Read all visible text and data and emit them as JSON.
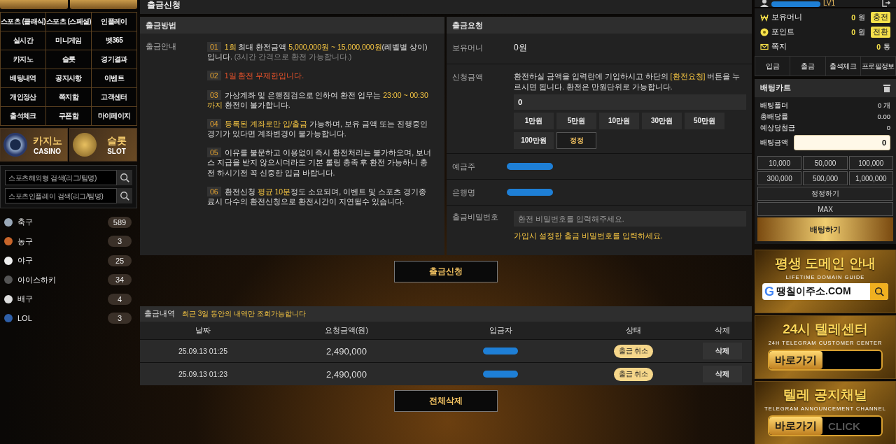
{
  "menu": [
    {
      "label": "스포츠 (클래식)"
    },
    {
      "label": "스포츠 (스페셜)"
    },
    {
      "label": "인플레이"
    },
    {
      "label": "실시간"
    },
    {
      "label": "미니게임"
    },
    {
      "label": "벳365"
    },
    {
      "label": "카지노"
    },
    {
      "label": "슬롯"
    },
    {
      "label": "경기결과"
    },
    {
      "label": "배팅내역"
    },
    {
      "label": "공지사항"
    },
    {
      "label": "이벤트"
    },
    {
      "label": "개인정산"
    },
    {
      "label": "쪽지함"
    },
    {
      "label": "고객센터"
    },
    {
      "label": "출석체크"
    },
    {
      "label": "쿠폰함"
    },
    {
      "label": "마이페이지"
    }
  ],
  "promo_banners": [
    {
      "kind": "casino",
      "title": "카지노",
      "subtitle": "CASINO"
    },
    {
      "kind": "slot",
      "title": "슬롯",
      "subtitle": "SLOT"
    }
  ],
  "search_fields": [
    {
      "placeholder": "스포츠해외형 검색(리그/팀명)"
    },
    {
      "placeholder": "스포츠인플레이 검색(리그/팀명)"
    }
  ],
  "sports": [
    {
      "kind": "soccer",
      "name": "축구",
      "count": "589"
    },
    {
      "kind": "basketball",
      "name": "농구",
      "count": "3"
    },
    {
      "kind": "baseball",
      "name": "야구",
      "count": "25"
    },
    {
      "kind": "hockey",
      "name": "아이스하키",
      "count": "34"
    },
    {
      "kind": "volleyball",
      "name": "배구",
      "count": "4"
    },
    {
      "kind": "lol",
      "name": "LOL",
      "count": "3"
    }
  ],
  "page_title": "출금신청",
  "method_panel": {
    "title": "출금방법",
    "label": "출금안내",
    "notices": [
      {
        "number": "01",
        "kind": "normal",
        "text": "**1회** 최대 환전금액 **5,000,000원 ~ 15,000,000원**(레벨별 상이) 입니다. *(3시간 간격으로 환전 가능합니다.)*"
      },
      {
        "number": "02",
        "kind": "warning",
        "text": "1일 환전 무제한입니다."
      },
      {
        "number": "03",
        "kind": "normal",
        "text": "가상계좌 및 은행점검으로 인하여 환전 업무는 **23:00 ~ 00:30 까지** 환전이 불가합니다."
      },
      {
        "number": "04",
        "kind": "normal",
        "text": "**등록된 계좌로만 입/출금** 가능하며, 보유 금액 또는 진행중인 경기가 있다면 계좌변경이 불가능합니다."
      },
      {
        "number": "05",
        "kind": "normal",
        "text": "이유를 불문하고 이용없이 즉시 환전처리는 불가하오며, 보너스 지급을 받지 않으시더라도 기본 롤링 충족 후 환전 가능하니 충전 하시기전 꼭 신중한 입금 바랍니다."
      },
      {
        "number": "06",
        "kind": "normal",
        "text": "환전신청 **평균 10분**정도 소요되며, 이벤트 및 스포츠 경기종료시 다수의 환전신청으로 환전시간이 지연될수 있습니다."
      }
    ]
  },
  "request_panel": {
    "title": "출금요청",
    "rows": [
      {
        "kind": "text",
        "label": "보유머니",
        "value": "0원"
      },
      {
        "kind": "amount",
        "label": "신청금액",
        "description": "환전하실 금액을 입력란에 기입하시고 하단의 **[환전요청]** 버튼을 누르시면 됩니다. 환전은 만원단위로 가능합니다.",
        "value": "0",
        "buttons": [
          "1만원",
          "5만원",
          "10만원",
          "30만원",
          "50만원",
          "100만원"
        ],
        "reset": "정정"
      },
      {
        "kind": "redacted",
        "label": "예금주"
      },
      {
        "kind": "redacted",
        "label": "은행명"
      },
      {
        "kind": "password",
        "label": "출금비밀번호",
        "placeholder": "환전 비밀번호를 입력해주세요.",
        "hint": "가입시 설정한 출금 비밀번호를 입력하세요."
      }
    ]
  },
  "submit_button": "출금신청",
  "history": {
    "title": "출금내역",
    "note": "최근 3일 동안의 내역만 조회가능합니다",
    "columns": [
      "날짜",
      "요청금액(원)",
      "입금자",
      "상태",
      "삭제"
    ],
    "rows": [
      {
        "date": "25.09.13 01:25",
        "amount": "2,490,000",
        "status": "출금 취소",
        "delete": "삭제"
      },
      {
        "date": "25.09.13 01:23",
        "amount": "2,490,000",
        "status": "출금 취소",
        "delete": "삭제"
      }
    ]
  },
  "delete_all_button": "전체삭제",
  "user": {
    "level": "LV1"
  },
  "balances": [
    {
      "kind": "money",
      "label": "보유머니",
      "value": "0",
      "unit": "원",
      "action": "충전"
    },
    {
      "kind": "point",
      "label": "포인트",
      "value": "0",
      "unit": "원",
      "action": "전환"
    },
    {
      "kind": "message",
      "label": "쪽지",
      "value": "0",
      "unit": "통"
    }
  ],
  "account_tabs": [
    "입금",
    "출금",
    "출석체크",
    "프로필정보"
  ],
  "bet_cart": {
    "title": "배팅카트",
    "stats": [
      {
        "label": "배팅폴더",
        "value": "0 개"
      },
      {
        "label": "총배당률",
        "value": "0.00"
      },
      {
        "label": "예상당첨금",
        "value": "0"
      }
    ],
    "amount_label": "배팅금액",
    "amount": "0",
    "chips": [
      "10,000",
      "50,000",
      "100,000",
      "300,000",
      "500,000",
      "1,000,000"
    ],
    "reset": "정정하기",
    "max": "MAX",
    "bet": "배팅하기"
  },
  "side_banners": [
    {
      "kind": "search",
      "title": "평생 도메인 안내",
      "subtitle": "LIFETIME DOMAIN GUIDE",
      "logo": "G",
      "action": "땡칠이주소.COM"
    },
    {
      "kind": "link",
      "title": "24시 텔레센터",
      "subtitle": "24H TELEGRAM CUSTOMER CENTER",
      "action": "바로가기"
    },
    {
      "kind": "link",
      "title": "텔레 공지채널",
      "subtitle": "TELEGRAM ANNOUNCEMENT CHANNEL",
      "action": "바로가기",
      "extra": "CLICK"
    }
  ]
}
